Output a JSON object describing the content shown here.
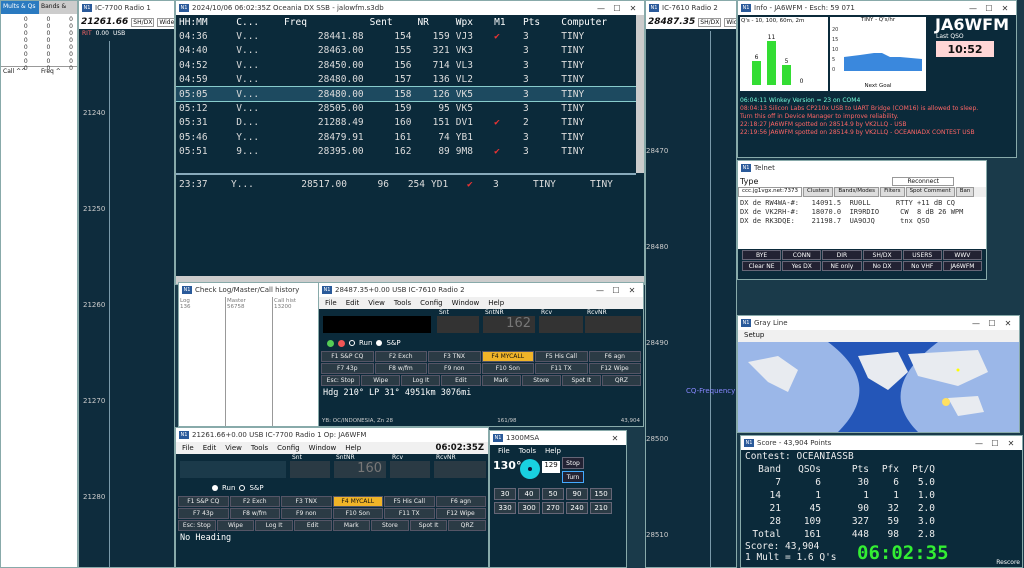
{
  "radio1_panel": {
    "title": "IC-7700 Radio 1",
    "freq": "21261.66",
    "mode_btn": "SH/DX",
    "wide_btn": "Wide",
    "rit": "RIT",
    "rit_val": "0.00",
    "mode": "USB",
    "ticks": [
      "21240",
      "21250",
      "21260",
      "21270",
      "21280"
    ]
  },
  "mults_panel": {
    "tab1": "Mults & Qs",
    "tab2": "Bands &",
    "zeros": [
      "0",
      "0",
      "0",
      "0",
      "0",
      "0",
      "0",
      "0",
      "0",
      "0",
      "0",
      "0",
      "0",
      "0",
      "0",
      "0",
      "0",
      "0",
      "0",
      "0",
      "0",
      "0",
      "0",
      "0"
    ],
    "col1": "Call ^^",
    "col2": "Freq ^"
  },
  "log_window": {
    "title": "2024/10/06 06:02:35Z  Oceania DX SSB - jalowfm.s3db",
    "headers": [
      "HH:MM",
      "C...",
      "Freq",
      "Sent",
      "NR",
      "Wpx",
      "M1",
      "Pts",
      "Computer"
    ],
    "rows": [
      {
        "time": "04:36",
        "c": "V...",
        "freq": "28441.88",
        "sent": "154",
        "nr": "159",
        "wpx": "VJ3",
        "m1": "✔",
        "pts": "3",
        "comp": "TINY"
      },
      {
        "time": "04:40",
        "c": "V...",
        "freq": "28463.00",
        "sent": "155",
        "nr": "321",
        "wpx": "VK3",
        "m1": "",
        "pts": "3",
        "comp": "TINY"
      },
      {
        "time": "04:52",
        "c": "V...",
        "freq": "28450.00",
        "sent": "156",
        "nr": "714",
        "wpx": "VL3",
        "m1": "",
        "pts": "3",
        "comp": "TINY"
      },
      {
        "time": "04:59",
        "c": "V...",
        "freq": "28480.00",
        "sent": "157",
        "nr": "136",
        "wpx": "VL2",
        "m1": "",
        "pts": "3",
        "comp": "TINY"
      },
      {
        "time": "05:05",
        "c": "V...",
        "freq": "28480.00",
        "sent": "158",
        "nr": "126",
        "wpx": "VK5",
        "m1": "",
        "pts": "3",
        "comp": "TINY"
      },
      {
        "time": "05:12",
        "c": "V...",
        "freq": "28505.00",
        "sent": "159",
        "nr": "95",
        "wpx": "VK5",
        "m1": "",
        "pts": "3",
        "comp": "TINY"
      },
      {
        "time": "05:31",
        "c": "D...",
        "freq": "21288.49",
        "sent": "160",
        "nr": "151",
        "wpx": "DV1",
        "m1": "✔",
        "pts": "2",
        "comp": "TINY"
      },
      {
        "time": "05:46",
        "c": "Y...",
        "freq": "28479.91",
        "sent": "161",
        "nr": "74",
        "wpx": "YB1",
        "m1": "",
        "pts": "3",
        "comp": "TINY"
      },
      {
        "time": "05:51",
        "c": "9...",
        "freq": "28395.00",
        "sent": "162",
        "nr": "89",
        "wpx": "9M8",
        "m1": "✔",
        "pts": "3",
        "comp": "TINY"
      }
    ],
    "bottom_row": {
      "time": "23:37",
      "c": "Y...",
      "freq": "28517.00",
      "sent": "96",
      "nr": "254",
      "wpx": "YD1",
      "m1": "✔",
      "pts": "3",
      "comp": "TINY",
      "comp2": "TINY"
    }
  },
  "radio2_panel": {
    "title": "IC-7610 Radio 2",
    "freq": "28487.35",
    "mode_btn": "SH/DX",
    "wide_btn": "Wide",
    "ticks": [
      "28470",
      "28480",
      "28490",
      "28500",
      "28510"
    ],
    "cq_label": "CQ-Frequency"
  },
  "info_window": {
    "title": "Info - JA6WFM - Esch: 59 071",
    "legend": "Q's - 10, 100, 60m, 2m",
    "bars": [
      {
        "label": "6",
        "value": 6
      },
      {
        "label": "11",
        "value": 11
      },
      {
        "label": "5",
        "value": 5
      },
      {
        "label": "0",
        "value": 0
      }
    ],
    "rate_title": "TINY - Q's/hr",
    "rate_ticks": [
      "20",
      "15",
      "10",
      "5",
      "0"
    ],
    "next_goal": "Next Goal",
    "callsign": "JA6WFM",
    "last_qso_label": "Last QSO",
    "last_qso": "10:52",
    "messages": [
      {
        "text": "06:04:11 Winkey Version = 23 on COM4",
        "color": "#7fd"
      },
      {
        "text": "08:04:13 Silicon Labs CP210x USB to UART Bridge (COM16) is allowed to sleep.",
        "color": "#f66"
      },
      {
        "text": "Turn this off in Device Manager to improve reliability.",
        "color": "#f66"
      },
      {
        "text": "22:18:27 JA6WFM spotted on 28514.9 by VK2LLQ - USB",
        "color": "#f66"
      },
      {
        "text": "22:19:56 JA6WFM spotted on 28514.9 by VK2LLQ - OCEANIADX CONTEST USB",
        "color": "#f66"
      }
    ]
  },
  "telnet_window": {
    "title": "Telnet",
    "type_label": "Type",
    "reconnect": "Reconnect",
    "tabs": [
      "ccc.jg1vgx.net:7373",
      "Clusters",
      "Bands/Modes",
      "Filters",
      "Spot Comment",
      "Ban"
    ],
    "lines": [
      "DX de RW4WA-#:   14091.5  RU0LL      RTTY +11 dB CQ",
      "DX de VK2RH-#:   18070.0  IR9RDIO     CW  8 dB 26 WPM",
      "DX de RK3DQE:    21198.7  UA9OJQ      tnx QSO"
    ],
    "buttons_row1": [
      "BYE",
      "CONN",
      "DIR",
      "SH/DX",
      "USERS",
      "WWV"
    ],
    "buttons_row2": [
      "Clear NE",
      "Yes DX",
      "NE only",
      "No DX",
      "No VHF",
      "JA6WFM"
    ]
  },
  "grayline_window": {
    "title": "Gray Line",
    "menu": "Setup"
  },
  "score_window": {
    "title": "Score - 43,904 Points",
    "contest": "Contest: OCEANIASSB",
    "headers": [
      "Band",
      "QSOs",
      "Pts",
      "Pfx",
      "Pt/Q"
    ],
    "rows": [
      [
        "7",
        "6",
        "30",
        "6",
        "5.0"
      ],
      [
        "14",
        "1",
        "1",
        "1",
        "1.0"
      ],
      [
        "21",
        "45",
        "90",
        "32",
        "2.0"
      ],
      [
        "28",
        "109",
        "327",
        "59",
        "3.0"
      ],
      [
        "Total",
        "161",
        "448",
        "98",
        "2.8"
      ]
    ],
    "score": "Score: 43,904",
    "mult": "1 Mult = 1.6 Q's",
    "clock": "06:02:35",
    "rescore": "Rescore"
  },
  "checklog_window": {
    "title": "Check Log/Master/Call history",
    "cols": [
      {
        "h": "Log",
        "v": "136"
      },
      {
        "h": "Master",
        "v": "56758"
      },
      {
        "h": "Call hist",
        "v": "13200"
      }
    ]
  },
  "entry2": {
    "title": "28487.35+0.00 USB IC-7610 Radio 2",
    "menu": [
      "File",
      "Edit",
      "View",
      "Tools",
      "Config",
      "Window",
      "Help"
    ],
    "labels": [
      "Snt",
      "SntNR",
      "Rcv",
      "RcvNR"
    ],
    "sntnr": "162",
    "run": "Run",
    "sp": "S&P",
    "fkeys1": [
      "F1 S&P CQ",
      "F2 Exch",
      "F3 TNX",
      "F4 MYCALL",
      "F5 His Call",
      "F6 agn"
    ],
    "fkeys2": [
      "F7 43p",
      "F8 w/fm",
      "F9 non",
      "F10 Son",
      "F11 TX",
      "F12 Wipe"
    ],
    "fkeys3": [
      "Esc: Stop",
      "Wipe",
      "Log It",
      "Edit",
      "Mark",
      "Store",
      "Spot It",
      "QRZ"
    ],
    "heading": "Hdg 210°  LP 31°  4951km  3076mi",
    "status_left": "YB: OC/INDONESIA, Zn 28",
    "status_mid": "161/98",
    "status_right": "43,904"
  },
  "entry1": {
    "title": "21261.66+0.00 USB IC-7700 Radio 1    Op: JA6WFM",
    "clock": "06:02:35Z",
    "menu": [
      "File",
      "Edit",
      "View",
      "Tools",
      "Config",
      "Window",
      "Help"
    ],
    "labels": [
      "Snt",
      "SntNR",
      "Rcv",
      "RcvNR"
    ],
    "sntnr": "160",
    "run": "Run",
    "sp": "S&P",
    "fkeys1": [
      "F1 S&P CQ",
      "F2 Exch",
      "F3 TNX",
      "F4 MYCALL",
      "F5 His Call",
      "F6 agn"
    ],
    "fkeys2": [
      "F7 43p",
      "F8 w/fm",
      "F9 non",
      "F10 Son",
      "F11 TX",
      "F12 Wipe"
    ],
    "fkeys3": [
      "Esc: Stop",
      "Wipe",
      "Log It",
      "Edit",
      "Mark",
      "Store",
      "Spot It",
      "QRZ"
    ],
    "heading": "No Heading"
  },
  "rotor": {
    "title": "1300MSA",
    "menu": [
      "File",
      "Tools",
      "Help"
    ],
    "heading": "130°",
    "target": "129",
    "stop": "Stop",
    "turn": "Turn",
    "presets1": [
      "30",
      "40",
      "50",
      "90",
      "150"
    ],
    "presets2": [
      "330",
      "300",
      "270",
      "240",
      "210"
    ]
  },
  "colors": {
    "highlight": "#f0b428",
    "bg": "#0b2a3a",
    "bars": "#33dd33"
  }
}
